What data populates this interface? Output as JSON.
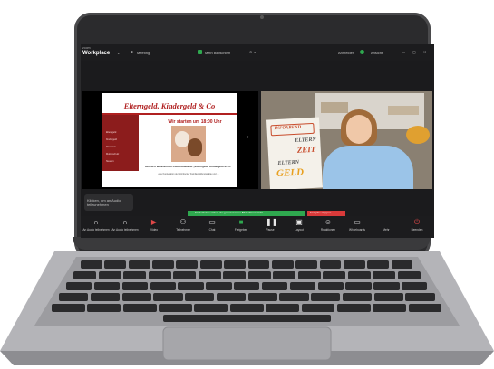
{
  "topbar": {
    "brand_small": "zoom",
    "brand": "Workplace",
    "meeting": "Meeting",
    "view_label": "Mein Bildschirm",
    "signin": "Anmelden",
    "view": "Ansicht"
  },
  "slide": {
    "title": "Elterngeld, Kindergeld & Co",
    "start": "Wir starten um 18:00 Uhr",
    "side_items": [
      "Elterngeld",
      "Kindergeld",
      "Elternzeit",
      "Mutterschutz",
      "Steuern"
    ],
    "welcome": "Herzlich Willkommen zum Infoabend „Elterngeld, Kindergeld & Co\"",
    "sub": "eine Kooperation der Nürnberger Familienbildungsstätte und …"
  },
  "flipchart": {
    "title": "INFOABEND",
    "line1": "ELTERN",
    "line2": "ZEIT",
    "line3": "ELTERN",
    "line4": "GELD"
  },
  "audio_popup": "Klicken, um an Audio teilzunehmen",
  "recording": {
    "banner": "Sie befinden sich in der gemeinsamen Bildschirmansicht",
    "stop": "Freigabe stoppen"
  },
  "toolbar": [
    {
      "icon": "headphones-icon",
      "label": "An Audio teilnehmen"
    },
    {
      "icon": "headphones-icon",
      "label": "An Audio teilnehmen"
    },
    {
      "icon": "video-icon",
      "label": "Video"
    },
    {
      "icon": "participants-icon",
      "label": "Teilnehmer"
    },
    {
      "icon": "chat-icon",
      "label": "Chat"
    },
    {
      "icon": "share-icon",
      "label": "Freigeben"
    },
    {
      "icon": "pause-icon",
      "label": "Pause"
    },
    {
      "icon": "layout-icon",
      "label": "Layout"
    },
    {
      "icon": "reactions-icon",
      "label": "Reaktionen"
    },
    {
      "icon": "whiteboard-icon",
      "label": "Whiteboards"
    },
    {
      "icon": "more-icon",
      "label": "Mehr"
    },
    {
      "icon": "leave-icon",
      "label": "Beenden"
    }
  ],
  "colors": {
    "accent_green": "#2fa84f",
    "stop_red": "#d93a3a",
    "slide_red": "#b02020"
  }
}
